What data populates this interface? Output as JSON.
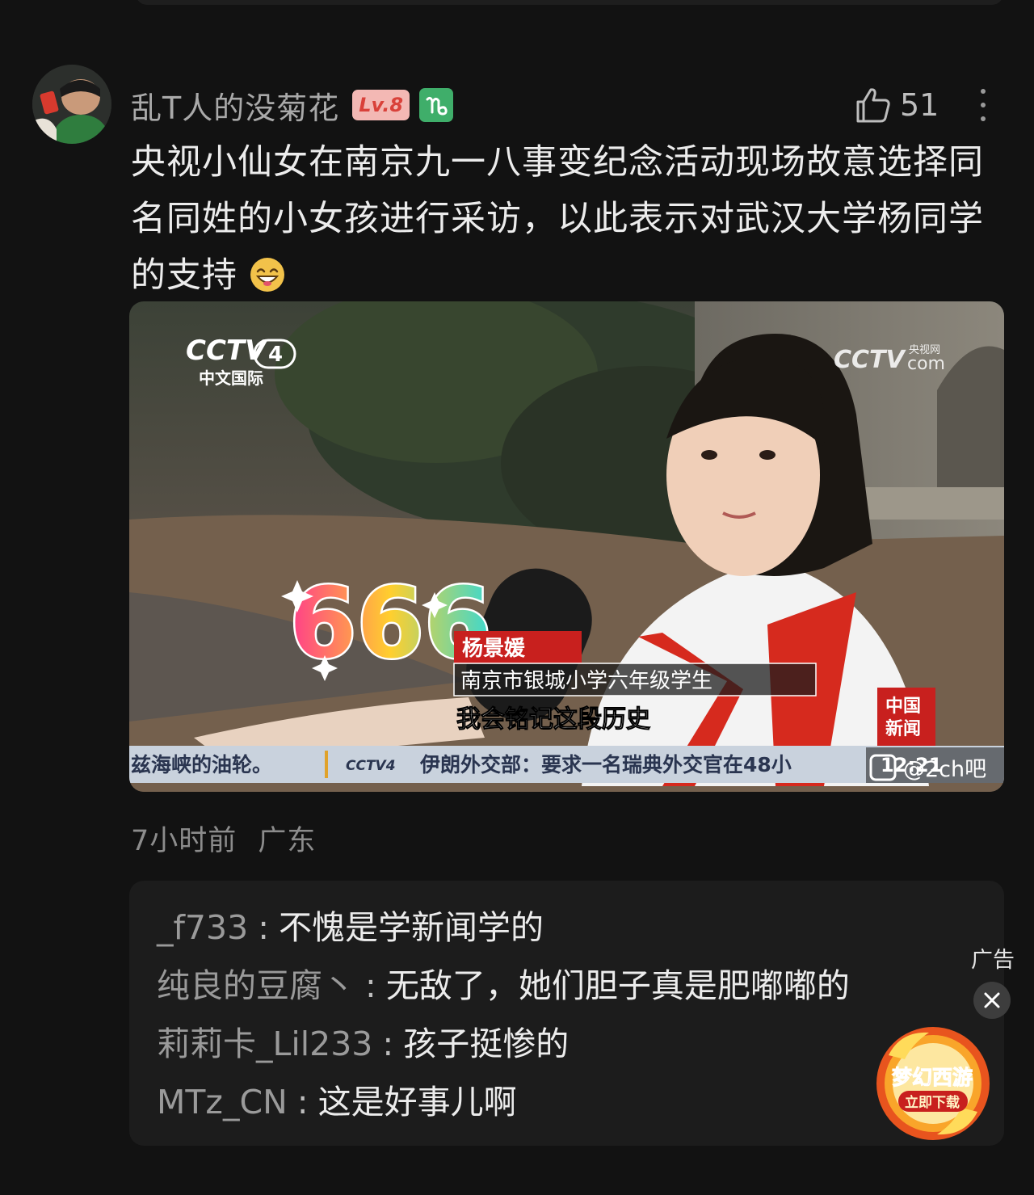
{
  "comment": {
    "username": "乱T人的没菊花",
    "level": "Lv.8",
    "zodiac_icon": "capricorn-icon",
    "like_count": "51",
    "text": "央视小仙女在南京九一八事变纪念活动现场故意选择同名同姓的小女孩进行采访，以此表示对武汉大学杨同学的支持",
    "emoji": "grinning-face-emoji",
    "time": "7小时前",
    "location": "广东"
  },
  "video": {
    "channel_logo": "CCTV 4",
    "channel_name": "中文国际",
    "site_logo": "CCTV.com",
    "site_label": "央视网",
    "sticker": "666",
    "name_caption": "杨景媛",
    "title_caption": "南京市银城小学六年级学生",
    "subtitle": "我会铭记这段历史",
    "corner_logo": "中国新闻",
    "ticker_left": "兹海峡的油轮。",
    "ticker_logo": "CCTV4",
    "ticker_right": "伊朗外交部：要求一名瑞典外交官在48小",
    "clock": "12:21",
    "watermark": "@2ch吧",
    "colors": {
      "caption_red": "#c8201e",
      "scarf_red": "#d62a1e"
    }
  },
  "replies": [
    {
      "name": "_f733",
      "text": "不愧是学新闻学的"
    },
    {
      "name": "纯良的豆腐丶",
      "text": "无敌了，她们胆子真是肥嘟嘟的"
    },
    {
      "name": "莉莉卡_Lil233",
      "text": "孩子挺惨的"
    },
    {
      "name": "MTz_CN",
      "text": "这是好事儿啊"
    }
  ],
  "ad": {
    "label": "广告",
    "game_name": "梦幻西游",
    "game_cta": "立即下载"
  }
}
